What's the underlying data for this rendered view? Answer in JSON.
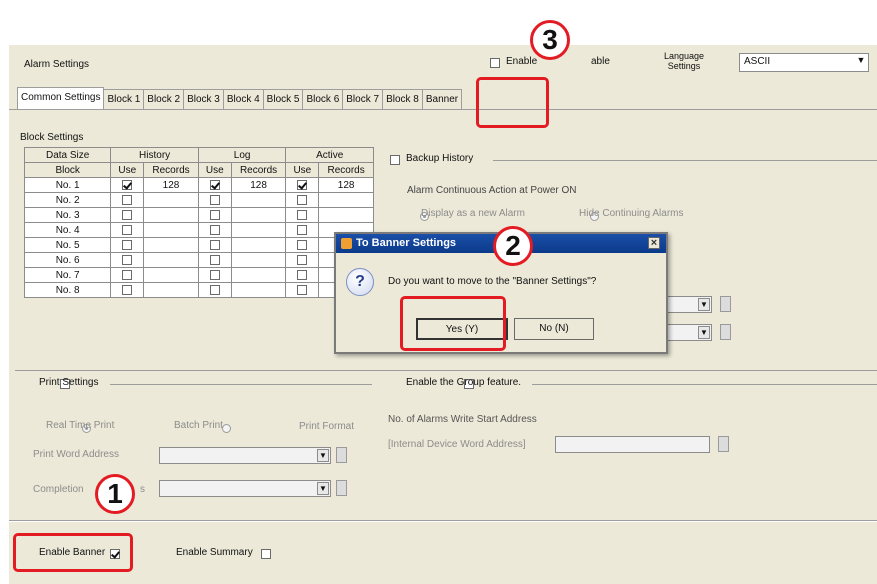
{
  "window": {
    "title": "Alarm Settings"
  },
  "header": {
    "enable_label": "Enable",
    "enable_label_tail": "able",
    "language_label_1": "Language",
    "language_label_2": "Settings",
    "language_value": "ASCII"
  },
  "tabs": [
    "Common Settings",
    "Block 1",
    "Block 2",
    "Block 3",
    "Block 4",
    "Block 5",
    "Block 6",
    "Block 7",
    "Block 8",
    "Banner"
  ],
  "block_settings": {
    "title": "Block Settings",
    "group_headers": [
      "Data Size",
      "History",
      "Log",
      "Active"
    ],
    "col_headers": [
      "Block",
      "Use",
      "Records",
      "Use",
      "Records",
      "Use",
      "Records"
    ],
    "rows": [
      {
        "block": "No. 1",
        "hist_use": true,
        "hist_rec": "128",
        "log_use": true,
        "log_rec": "128",
        "act_use": true,
        "act_rec": "128"
      },
      {
        "block": "No. 2",
        "hist_use": false,
        "hist_rec": "",
        "log_use": false,
        "log_rec": "",
        "act_use": false,
        "act_rec": ""
      },
      {
        "block": "No. 3",
        "hist_use": false,
        "hist_rec": "",
        "log_use": false,
        "log_rec": "",
        "act_use": false,
        "act_rec": ""
      },
      {
        "block": "No. 4",
        "hist_use": false,
        "hist_rec": "",
        "log_use": false,
        "log_rec": "",
        "act_use": false,
        "act_rec": ""
      },
      {
        "block": "No. 5",
        "hist_use": false,
        "hist_rec": "",
        "log_use": false,
        "log_rec": "",
        "act_use": false,
        "act_rec": ""
      },
      {
        "block": "No. 6",
        "hist_use": false,
        "hist_rec": "",
        "log_use": false,
        "log_rec": "",
        "act_use": false,
        "act_rec": ""
      },
      {
        "block": "No. 7",
        "hist_use": false,
        "hist_rec": "",
        "log_use": false,
        "log_rec": "",
        "act_use": false,
        "act_rec": ""
      },
      {
        "block": "No. 8",
        "hist_use": false,
        "hist_rec": "",
        "log_use": false,
        "log_rec": "",
        "act_use": false,
        "act_rec": ""
      }
    ]
  },
  "backup": {
    "label": "Backup History",
    "continuous_title": "Alarm Continuous Action at Power ON",
    "radio_display": "Display as a new Alarm",
    "radio_hide": "Hide Continuing Alarms"
  },
  "dialog": {
    "title": "To Banner Settings",
    "message": "Do you want to move to the \"Banner Settings\"?",
    "yes_label": "Yes (Y)",
    "no_label": "No (N)",
    "close_glyph": "×",
    "icon_glyph": "?"
  },
  "print": {
    "label": "Print Settings",
    "radio_real": "Real Time Print",
    "radio_batch": "Batch Print",
    "format_label": "Print Format",
    "word_address_label": "Print Word Address",
    "completion_label": "Completion",
    "completion_tail": "s"
  },
  "group": {
    "label": "Enable the Group feature.",
    "write_start_label": "No. of Alarms Write Start Address",
    "internal_label": "[Internal Device Word Address]"
  },
  "footer": {
    "enable_banner": "Enable Banner",
    "enable_summary": "Enable Summary"
  },
  "callouts": [
    "1",
    "2",
    "3"
  ]
}
